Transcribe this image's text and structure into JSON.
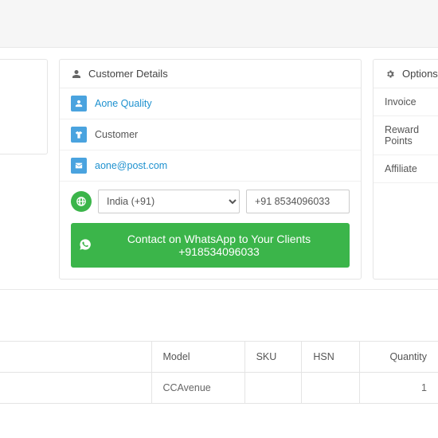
{
  "customer": {
    "panel_title": "Customer Details",
    "name": "Aone Quality",
    "group": "Customer",
    "email": "aone@post.com",
    "country_code": "India (+91)",
    "phone": "+91 8534096033",
    "whatsapp_label": "Contact on WhatsApp to Your Clients +918534096033"
  },
  "options": {
    "panel_title": "Options",
    "items": [
      "Invoice",
      "Reward Points",
      "Affiliate"
    ]
  },
  "table": {
    "headers": {
      "model": "Model",
      "sku": "SKU",
      "hsn": "HSN",
      "qty": "Quantity"
    },
    "rows": [
      {
        "model": "CCAvenue",
        "sku": "",
        "hsn": "",
        "qty": "1"
      }
    ]
  }
}
